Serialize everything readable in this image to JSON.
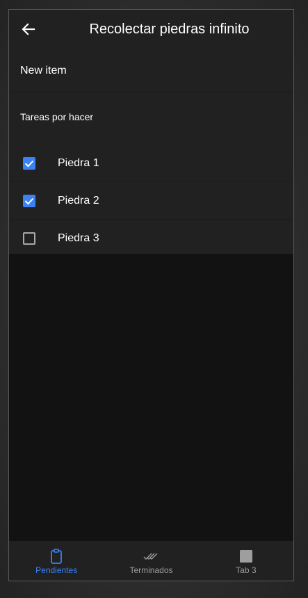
{
  "header": {
    "title": "Recolectar piedras infinito",
    "back_icon": "arrow-left-icon"
  },
  "new_item": {
    "placeholder": "New item"
  },
  "section": {
    "title": "Tareas por hacer"
  },
  "tasks": [
    {
      "label": "Piedra 1",
      "checked": true
    },
    {
      "label": "Piedra 2",
      "checked": true
    },
    {
      "label": "Piedra 3",
      "checked": false
    }
  ],
  "bottom_nav": {
    "tabs": [
      {
        "label": "Pendientes",
        "icon": "clipboard-icon",
        "active": true
      },
      {
        "label": "Terminados",
        "icon": "double-check-icon",
        "active": false
      },
      {
        "label": "Tab 3",
        "icon": "square-icon",
        "active": false
      }
    ]
  },
  "colors": {
    "accent": "#3b82f6",
    "surface": "#212121",
    "background": "#121212",
    "inactive_tab": "#9e9e9e"
  }
}
